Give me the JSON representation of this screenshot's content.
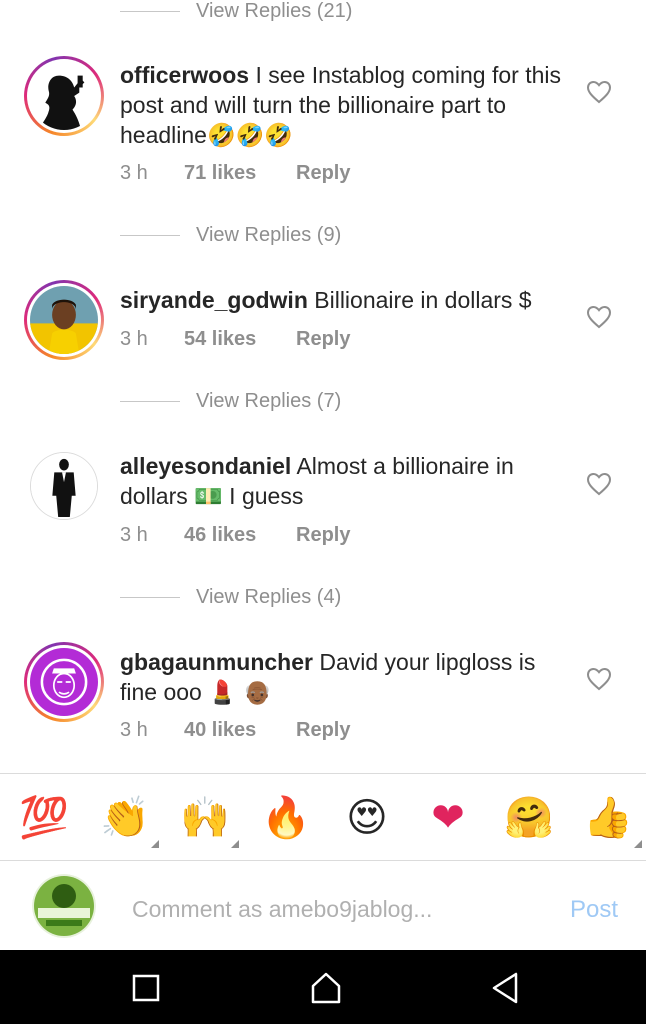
{
  "comments": [
    {
      "username": "officerwoos",
      "text": "I see Instablog coming for this post and will turn the billionaire part to headline🤣🤣🤣",
      "time": "3 h",
      "likes": "71 likes",
      "reply": "Reply",
      "view_replies_above": "View Replies (21)",
      "view_replies_below": "View Replies (9)"
    },
    {
      "username": "siryande_godwin",
      "text": "Billionaire in dollars $",
      "time": "3 h",
      "likes": "54 likes",
      "reply": "Reply",
      "view_replies_below": "View Replies (7)"
    },
    {
      "username": "alleyesondaniel",
      "text": "Almost a billionaire in dollars 💵 I guess",
      "time": "3 h",
      "likes": "46 likes",
      "reply": "Reply",
      "view_replies_below": "View Replies (4)"
    },
    {
      "username": "gbagaunmuncher",
      "text": "David your lipgloss is fine ooo 💄 👴🏾",
      "time": "3 h",
      "likes": "40 likes",
      "reply": "Reply"
    }
  ],
  "emoji_bar": [
    {
      "glyph": "💯",
      "name": "hundred-points"
    },
    {
      "glyph": "👏",
      "name": "clapping-hands",
      "has_variants": true
    },
    {
      "glyph": "🙌",
      "name": "raising-hands",
      "has_variants": true
    },
    {
      "glyph": "🔥",
      "name": "fire"
    },
    {
      "glyph": "😍",
      "name": "heart-eyes"
    },
    {
      "glyph": "❤",
      "name": "red-heart"
    },
    {
      "glyph": "🤗",
      "name": "hugging-face"
    },
    {
      "glyph": "👍",
      "name": "thumbs-up",
      "has_variants": true
    }
  ],
  "composer": {
    "placeholder": "Comment as amebo9jablog...",
    "post_label": "Post"
  },
  "colors": {
    "muted": "#8e8e8e",
    "text": "#262626",
    "post_disabled": "#9fc9f5",
    "navbar": "#000000"
  },
  "navbar": {
    "icons": [
      "overview-square-icon",
      "home-icon",
      "back-triangle-icon"
    ]
  }
}
